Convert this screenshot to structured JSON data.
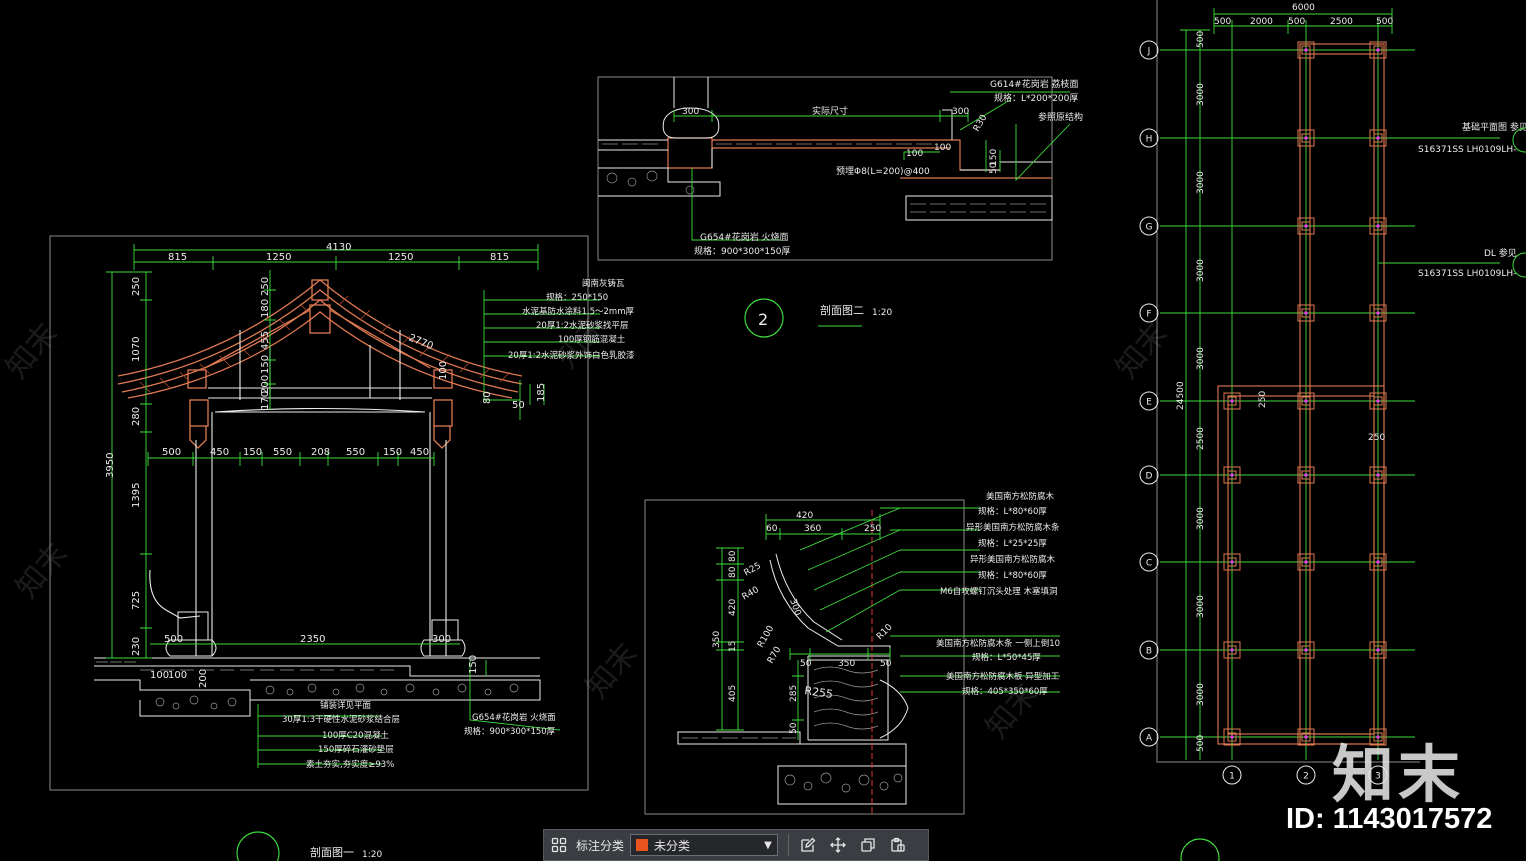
{
  "section1": {
    "title": "剖面图一",
    "scale": "1:20",
    "top_total": "4130",
    "top_dims": [
      "815",
      "1250",
      "1250",
      "815"
    ],
    "mid_dims": [
      "500",
      "450",
      "150",
      "550",
      "208",
      "550",
      "150",
      "450"
    ],
    "left_dims": [
      "250",
      "1070",
      "280",
      "1395",
      "725",
      "230"
    ],
    "left_total": "3950",
    "inner_dims": [
      "250",
      "180",
      "455",
      "150",
      "200",
      "170"
    ],
    "slope_label": "2770",
    "eave_dims": [
      "80",
      "50",
      "185",
      "100"
    ],
    "bottom_dims": [
      "500",
      "2350",
      "300",
      "150",
      "100",
      "100",
      "200"
    ],
    "roof_notes": [
      "闽南灰铸瓦",
      "规格：250*150",
      "水泥基防水涂料1.5～2mm厚",
      "20厚1:2水泥砂浆找平层",
      "100厚钢筋混凝土",
      "20厚1:2水泥砂浆外饰白色乳胶漆"
    ],
    "base_notes": [
      "铺装详见平面",
      "30厚1:3干硬性水泥砂浆结合层",
      "100厚C20混凝土",
      "150厚碎石灌砂垫层",
      "素土夯实,夯实度≥93%"
    ],
    "paving_note1": "G654#花岗岩 火烧面",
    "paving_note2": "规格：900*300*150厚"
  },
  "section2": {
    "number": "2",
    "title": "剖面图二",
    "scale": "1:20",
    "dims": [
      "300",
      "实际尺寸",
      "300",
      "100",
      "100",
      "150",
      "50",
      "R30"
    ],
    "notes": [
      "G614#花岗岩 荔枝面",
      "规格：L*200*200厚",
      "参照原结构",
      "预埋Φ8(L=200)@400",
      "G654#花岗岩 火烧面",
      "规格：900*300*150厚"
    ]
  },
  "detail3": {
    "top_dims": [
      "420",
      "60",
      "360",
      "250"
    ],
    "left_dims": [
      "80",
      "80",
      "420",
      "15",
      "405",
      "350"
    ],
    "inner_dims": [
      "R25",
      "R40",
      "300",
      "R100",
      "R70",
      "50",
      "350",
      "50",
      "285",
      "50"
    ],
    "radii": [
      "R255",
      "R10"
    ],
    "notes": [
      "美国南方松防腐木",
      "规格：L*80*60厚",
      "异形美国南方松防腐木条",
      "规格：L*25*25厚",
      "异形美国南方松防腐木",
      "规格：L*80*60厚",
      "M6自攻螺钉沉头处理 木塞填洞",
      "美国南方松防腐木条 一侧上倒10",
      "规格：L*50*45厚",
      "美国南方松防腐木板 异型加工",
      "规格：405*350*60厚"
    ]
  },
  "plan": {
    "top_total": "6000",
    "top_dims": [
      "500",
      "2000",
      "500",
      "2500",
      "500"
    ],
    "row_labels": [
      "J",
      "H",
      "G",
      "F",
      "E",
      "D",
      "C",
      "B",
      "A"
    ],
    "col_labels": [
      "1",
      "2",
      "3"
    ],
    "left_dims": [
      "500",
      "3000",
      "3000",
      "3000",
      "3000",
      "2500",
      "3000",
      "3000",
      "3000",
      "500"
    ],
    "left_total": "24500",
    "inner_dims": [
      "250",
      "250"
    ],
    "notes": [
      "基础平面图 参见",
      "S16371SS LH0109LH-",
      "DL 参见",
      "S16371SS LH0109LH-"
    ]
  },
  "toolbar": {
    "label": "标注分类",
    "select_value": "未分类",
    "select_color": "#e8541d"
  },
  "watermark": {
    "logo": "知末",
    "id": "ID: 1143017572"
  },
  "colors": {
    "green": "#3ddc3d",
    "white": "#ececec",
    "salmon": "#e07a52",
    "red": "#d8393a",
    "frame": "#8a8a8a",
    "magenta": "#e040e0"
  }
}
